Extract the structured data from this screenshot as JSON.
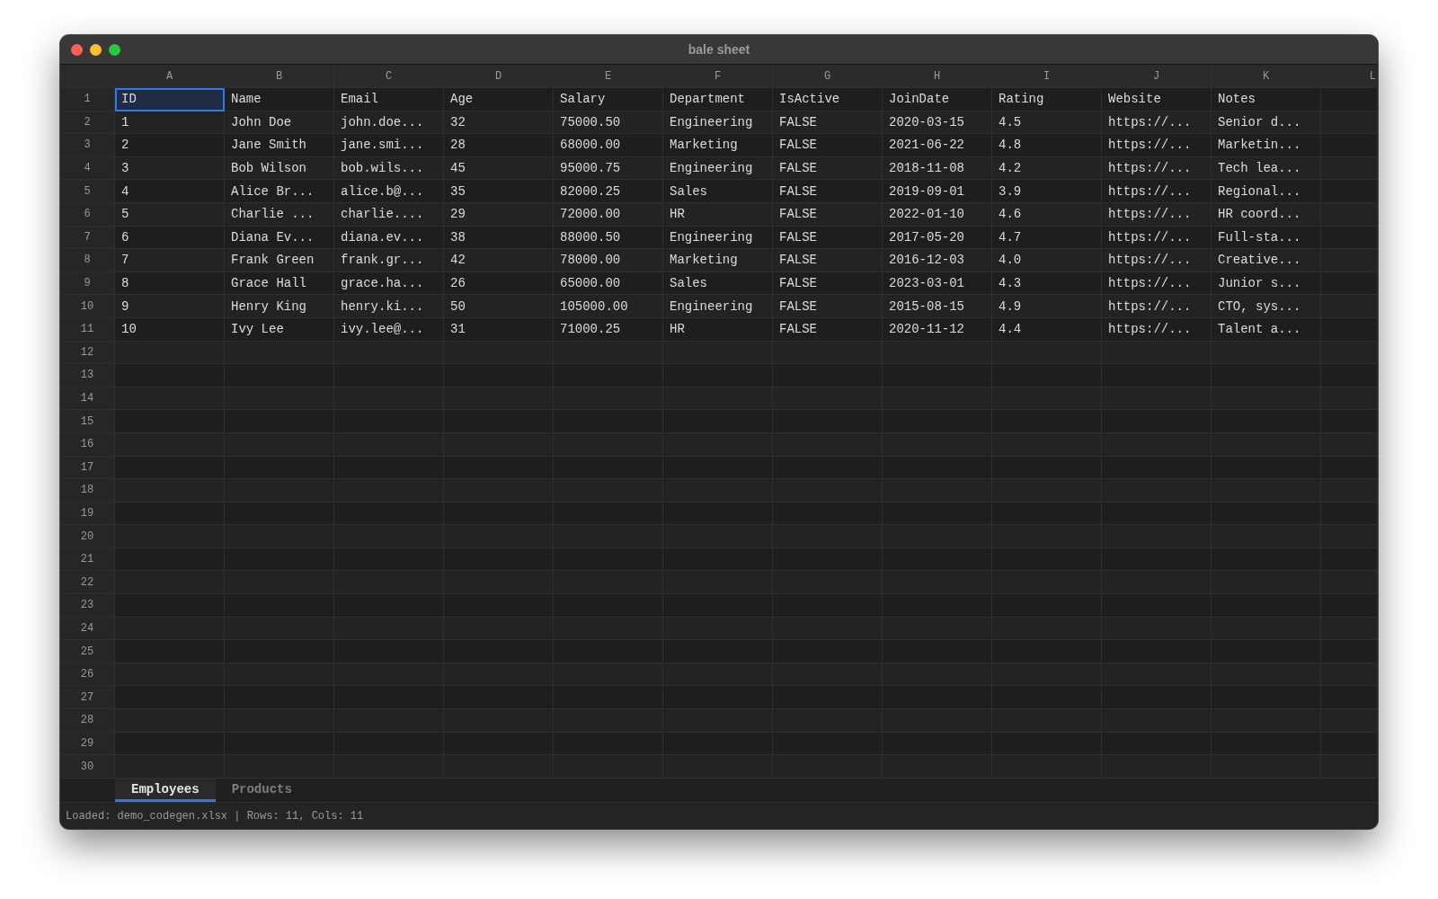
{
  "window": {
    "title": "bale sheet"
  },
  "columns": [
    "A",
    "B",
    "C",
    "D",
    "E",
    "F",
    "G",
    "H",
    "I",
    "J",
    "K",
    "L"
  ],
  "rows": [
    {
      "number": "1",
      "cells": [
        {
          "text": "ID",
          "selected": true
        },
        {
          "text": "Name",
          "selected": false
        },
        {
          "text": "Email",
          "selected": false
        },
        {
          "text": "Age",
          "selected": false
        },
        {
          "text": "Salary",
          "selected": false
        },
        {
          "text": "Department",
          "selected": false
        },
        {
          "text": "IsActive",
          "selected": false
        },
        {
          "text": "JoinDate",
          "selected": false
        },
        {
          "text": "Rating",
          "selected": false
        },
        {
          "text": "Website",
          "selected": false
        },
        {
          "text": "Notes",
          "selected": false
        }
      ]
    },
    {
      "number": "2",
      "cells": [
        {
          "text": "1",
          "selected": false
        },
        {
          "text": "John Doe",
          "selected": false
        },
        {
          "text": "john.doe...",
          "selected": false
        },
        {
          "text": "32",
          "selected": false
        },
        {
          "text": "75000.50",
          "selected": false
        },
        {
          "text": "Engineering",
          "selected": false
        },
        {
          "text": "FALSE",
          "selected": false
        },
        {
          "text": "2020-03-15",
          "selected": false
        },
        {
          "text": "4.5",
          "selected": false
        },
        {
          "text": "https://...",
          "selected": false
        },
        {
          "text": "Senior d...",
          "selected": false
        }
      ]
    },
    {
      "number": "3",
      "cells": [
        {
          "text": "2",
          "selected": false
        },
        {
          "text": "Jane Smith",
          "selected": false
        },
        {
          "text": "jane.smi...",
          "selected": false
        },
        {
          "text": "28",
          "selected": false
        },
        {
          "text": "68000.00",
          "selected": false
        },
        {
          "text": "Marketing",
          "selected": false
        },
        {
          "text": "FALSE",
          "selected": false
        },
        {
          "text": "2021-06-22",
          "selected": false
        },
        {
          "text": "4.8",
          "selected": false
        },
        {
          "text": "https://...",
          "selected": false
        },
        {
          "text": "Marketin...",
          "selected": false
        }
      ]
    },
    {
      "number": "4",
      "cells": [
        {
          "text": "3",
          "selected": false
        },
        {
          "text": "Bob Wilson",
          "selected": false
        },
        {
          "text": "bob.wils...",
          "selected": false
        },
        {
          "text": "45",
          "selected": false
        },
        {
          "text": "95000.75",
          "selected": false
        },
        {
          "text": "Engineering",
          "selected": false
        },
        {
          "text": "FALSE",
          "selected": false
        },
        {
          "text": "2018-11-08",
          "selected": false
        },
        {
          "text": "4.2",
          "selected": false
        },
        {
          "text": "https://...",
          "selected": false
        },
        {
          "text": "Tech lea...",
          "selected": false
        }
      ]
    },
    {
      "number": "5",
      "cells": [
        {
          "text": "4",
          "selected": false
        },
        {
          "text": "Alice Br...",
          "selected": false
        },
        {
          "text": "alice.b@...",
          "selected": false
        },
        {
          "text": "35",
          "selected": false
        },
        {
          "text": "82000.25",
          "selected": false
        },
        {
          "text": "Sales",
          "selected": false
        },
        {
          "text": "FALSE",
          "selected": false
        },
        {
          "text": "2019-09-01",
          "selected": false
        },
        {
          "text": "3.9",
          "selected": false
        },
        {
          "text": "https://...",
          "selected": false
        },
        {
          "text": "Regional...",
          "selected": false
        }
      ]
    },
    {
      "number": "6",
      "cells": [
        {
          "text": "5",
          "selected": false
        },
        {
          "text": "Charlie ...",
          "selected": false
        },
        {
          "text": "charlie....",
          "selected": false
        },
        {
          "text": "29",
          "selected": false
        },
        {
          "text": "72000.00",
          "selected": false
        },
        {
          "text": "HR",
          "selected": false
        },
        {
          "text": "FALSE",
          "selected": false
        },
        {
          "text": "2022-01-10",
          "selected": false
        },
        {
          "text": "4.6",
          "selected": false
        },
        {
          "text": "https://...",
          "selected": false
        },
        {
          "text": "HR coord...",
          "selected": false
        }
      ]
    },
    {
      "number": "7",
      "cells": [
        {
          "text": "6",
          "selected": false
        },
        {
          "text": "Diana Ev...",
          "selected": false
        },
        {
          "text": "diana.ev...",
          "selected": false
        },
        {
          "text": "38",
          "selected": false
        },
        {
          "text": "88000.50",
          "selected": false
        },
        {
          "text": "Engineering",
          "selected": false
        },
        {
          "text": "FALSE",
          "selected": false
        },
        {
          "text": "2017-05-20",
          "selected": false
        },
        {
          "text": "4.7",
          "selected": false
        },
        {
          "text": "https://...",
          "selected": false
        },
        {
          "text": "Full-sta...",
          "selected": false
        }
      ]
    },
    {
      "number": "8",
      "cells": [
        {
          "text": "7",
          "selected": false
        },
        {
          "text": "Frank Green",
          "selected": false
        },
        {
          "text": "frank.gr...",
          "selected": false
        },
        {
          "text": "42",
          "selected": false
        },
        {
          "text": "78000.00",
          "selected": false
        },
        {
          "text": "Marketing",
          "selected": false
        },
        {
          "text": "FALSE",
          "selected": false
        },
        {
          "text": "2016-12-03",
          "selected": false
        },
        {
          "text": "4.0",
          "selected": false
        },
        {
          "text": "https://...",
          "selected": false
        },
        {
          "text": "Creative...",
          "selected": false
        }
      ]
    },
    {
      "number": "9",
      "cells": [
        {
          "text": "8",
          "selected": false
        },
        {
          "text": "Grace Hall",
          "selected": false
        },
        {
          "text": "grace.ha...",
          "selected": false
        },
        {
          "text": "26",
          "selected": false
        },
        {
          "text": "65000.00",
          "selected": false
        },
        {
          "text": "Sales",
          "selected": false
        },
        {
          "text": "FALSE",
          "selected": false
        },
        {
          "text": "2023-03-01",
          "selected": false
        },
        {
          "text": "4.3",
          "selected": false
        },
        {
          "text": "https://...",
          "selected": false
        },
        {
          "text": "Junior s...",
          "selected": false
        }
      ]
    },
    {
      "number": "10",
      "cells": [
        {
          "text": "9",
          "selected": false
        },
        {
          "text": "Henry King",
          "selected": false
        },
        {
          "text": "henry.ki...",
          "selected": false
        },
        {
          "text": "50",
          "selected": false
        },
        {
          "text": "105000.00",
          "selected": false
        },
        {
          "text": "Engineering",
          "selected": false
        },
        {
          "text": "FALSE",
          "selected": false
        },
        {
          "text": "2015-08-15",
          "selected": false
        },
        {
          "text": "4.9",
          "selected": false
        },
        {
          "text": "https://...",
          "selected": false
        },
        {
          "text": "CTO, sys...",
          "selected": false
        }
      ]
    },
    {
      "number": "11",
      "cells": [
        {
          "text": "10",
          "selected": false
        },
        {
          "text": "Ivy Lee",
          "selected": false
        },
        {
          "text": "ivy.lee@...",
          "selected": false
        },
        {
          "text": "31",
          "selected": false
        },
        {
          "text": "71000.25",
          "selected": false
        },
        {
          "text": "HR",
          "selected": false
        },
        {
          "text": "FALSE",
          "selected": false
        },
        {
          "text": "2020-11-12",
          "selected": false
        },
        {
          "text": "4.4",
          "selected": false
        },
        {
          "text": "https://...",
          "selected": false
        },
        {
          "text": "Talent a...",
          "selected": false
        }
      ]
    },
    {
      "number": "12"
    },
    {
      "number": "13"
    },
    {
      "number": "14"
    },
    {
      "number": "15"
    },
    {
      "number": "16"
    },
    {
      "number": "17"
    },
    {
      "number": "18"
    },
    {
      "number": "19"
    },
    {
      "number": "20"
    },
    {
      "number": "21"
    },
    {
      "number": "22"
    },
    {
      "number": "23"
    },
    {
      "number": "24"
    },
    {
      "number": "25"
    },
    {
      "number": "26"
    },
    {
      "number": "27"
    },
    {
      "number": "28"
    },
    {
      "number": "29"
    },
    {
      "number": "30"
    }
  ],
  "tabs": [
    {
      "label": "Employees",
      "selected": true
    },
    {
      "label": "Products",
      "selected": false
    }
  ],
  "status_bar": "Loaded: demo_codegen.xlsx | Rows: 11, Cols: 11"
}
